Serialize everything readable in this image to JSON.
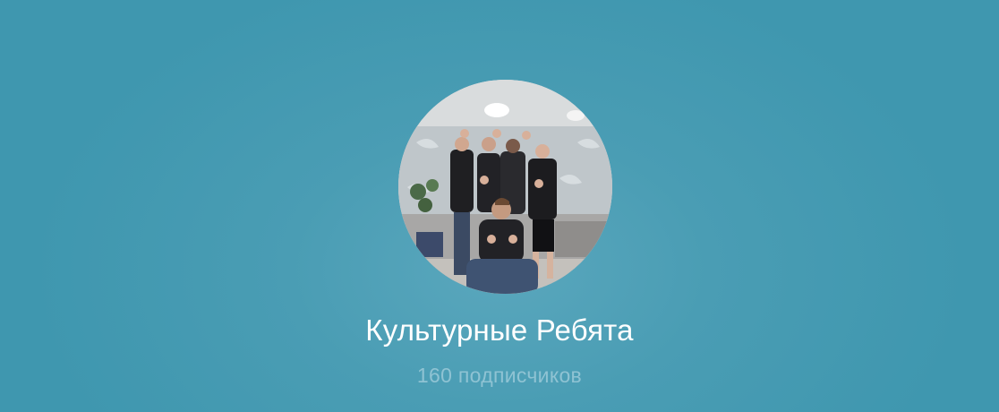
{
  "channel": {
    "name": "Культурные Ребята",
    "subscribers": "160 подписчиков",
    "avatar_icon": "group-photo-avatar"
  },
  "colors": {
    "background": "#3f97af",
    "title": "#ffffff",
    "subtitle": "#8fc3d3"
  }
}
